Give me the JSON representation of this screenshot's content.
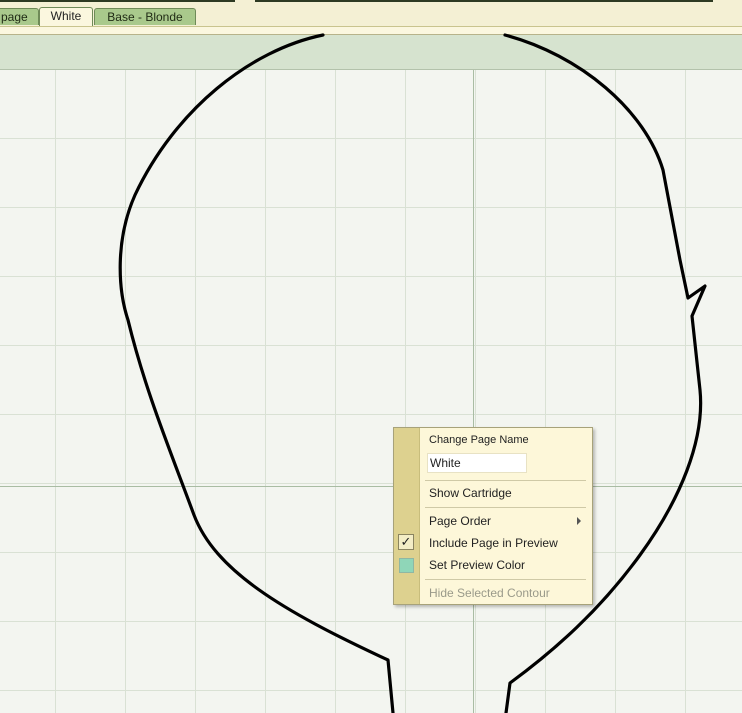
{
  "tabs": [
    {
      "label": "page",
      "active": false
    },
    {
      "label": "White",
      "active": true
    },
    {
      "label": "Base - Blonde",
      "active": false
    }
  ],
  "context_menu": {
    "change_name_label": "Change Page Name",
    "name_value": "White",
    "show_cartridge": "Show Cartridge",
    "page_order": "Page Order",
    "include_in_preview": "Include Page in Preview",
    "include_in_preview_checked": true,
    "set_preview_color": "Set Preview Color",
    "preview_color": "#8fd6b8",
    "hide_selected_contour": "Hide Selected Contour"
  },
  "colors": {
    "tab_inactive": "#a9c98c",
    "tab_active": "#fbf7df",
    "menu_gutter": "#ddd18f",
    "menu_background": "#fdf7d9"
  }
}
